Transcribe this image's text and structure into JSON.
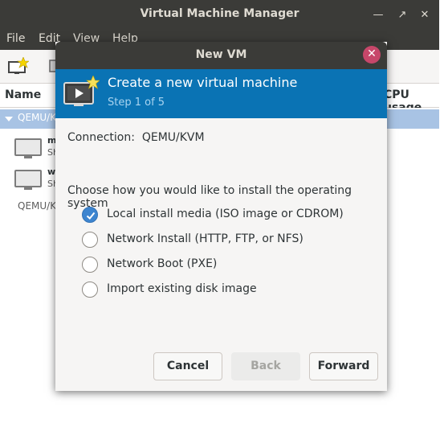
{
  "main_window": {
    "title": "Virtual Machine Manager",
    "menu": [
      "File",
      "Edit",
      "View",
      "Help"
    ],
    "columns": {
      "name": "Name",
      "cpu": "CPU usage"
    },
    "group": "QEMU/KVM",
    "vms": [
      {
        "name": "m",
        "status": "Sh"
      },
      {
        "name": "w",
        "status": "Sh"
      }
    ],
    "connection_item": "QEMU/KVM"
  },
  "dialog": {
    "title": "New VM",
    "banner_title": "Create a new virtual machine",
    "banner_step": "Step 1 of 5",
    "connection": "Connection:  QEMU/KVM",
    "question": "Choose how you would like to install the operating system",
    "options": [
      {
        "label": "Local install media (ISO image or CDROM)",
        "checked": true
      },
      {
        "label": "Network Install (HTTP, FTP, or NFS)",
        "checked": false
      },
      {
        "label": "Network Boot (PXE)",
        "checked": false
      },
      {
        "label": "Import existing disk image",
        "checked": false
      }
    ],
    "buttons": {
      "cancel": "Cancel",
      "back": "Back",
      "forward": "Forward"
    }
  },
  "colors": {
    "accent": "#0a73b4",
    "selection": "#a8c3e4",
    "radio_checked": "#3d85d0",
    "close": "#c7476a"
  }
}
